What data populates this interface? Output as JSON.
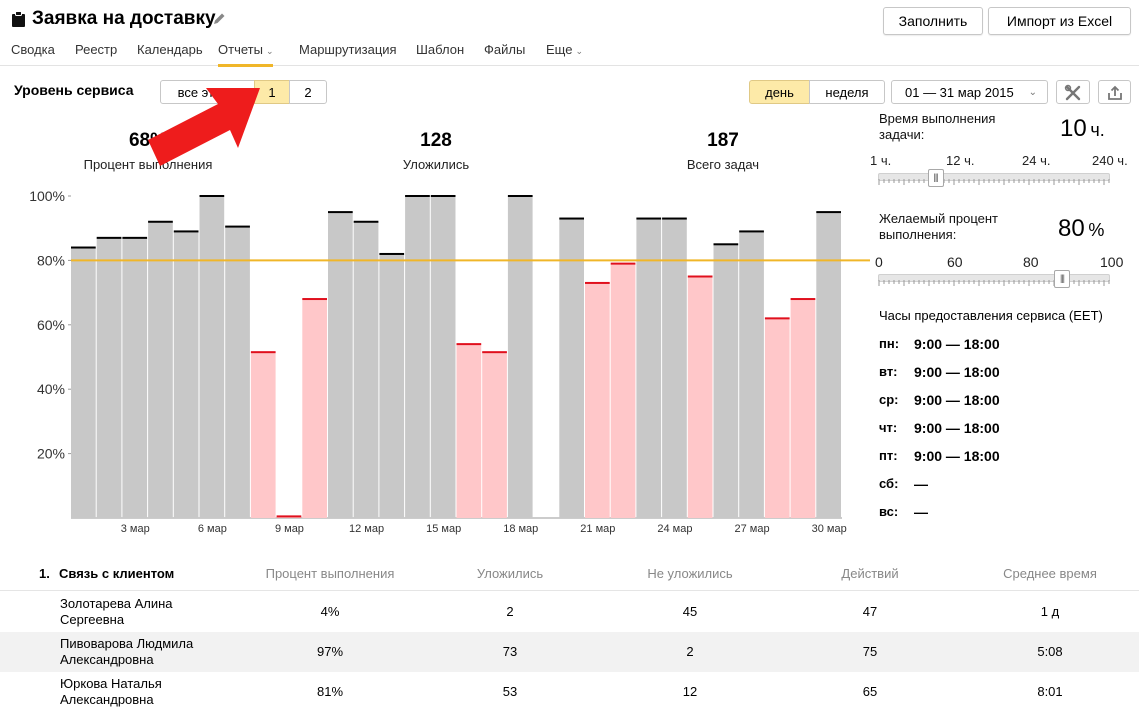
{
  "header": {
    "title": "Заявка на доставку",
    "fill_button": "Заполнить",
    "import_button": "Импорт из Excel"
  },
  "tabs": [
    {
      "label": "Сводка",
      "active": false
    },
    {
      "label": "Реестр",
      "active": false
    },
    {
      "label": "Календарь",
      "active": false
    },
    {
      "label": "Отчеты",
      "active": true,
      "dropdown": true
    },
    {
      "label": "Маршрутизация",
      "active": false
    },
    {
      "label": "Шаблон",
      "active": false
    },
    {
      "label": "Файлы",
      "active": false
    },
    {
      "label": "Еще",
      "active": false,
      "dropdown": true
    }
  ],
  "toolbar": {
    "report_title": "Уровень сервиса",
    "stages": [
      "все этапы",
      "1",
      "2"
    ],
    "selected_stage": "1",
    "periods": [
      "день",
      "неделя"
    ],
    "selected_period": "день",
    "date_range": "01 — 31 мар 2015"
  },
  "stats": [
    {
      "value": "68%",
      "label": "Процент выполнения"
    },
    {
      "value": "128",
      "label": "Уложились"
    },
    {
      "value": "187",
      "label": "Всего задач"
    }
  ],
  "chart_data": {
    "type": "bar",
    "ylim": [
      0,
      100
    ],
    "y_ticks": [
      "20%",
      "40%",
      "60%",
      "80%",
      "100%"
    ],
    "target_line": 80,
    "x_tick_labels": [
      "3 мар",
      "6 мар",
      "9 мар",
      "12 мар",
      "15 мар",
      "18 мар",
      "21 мар",
      "24 мар",
      "27 мар",
      "30 мар"
    ],
    "series": [
      {
        "values": [
          84,
          87,
          87,
          92,
          89,
          100,
          90.5,
          51.5,
          0.5,
          68,
          95,
          92,
          82,
          100,
          100,
          54,
          51.5,
          100,
          null,
          93,
          73,
          79,
          93,
          93,
          75,
          85,
          89,
          62,
          68,
          95
        ]
      }
    ],
    "colors": {
      "met": "#c8c8c8",
      "missed": "#ffc7c9",
      "met_cap": "#000000",
      "missed_cap": "#e0101d",
      "target": "#f0b629"
    }
  },
  "settings": {
    "task_time_label": "Время выполнения задачи:",
    "task_time_value": "10",
    "task_time_unit": "ч.",
    "task_time_scale": [
      "1 ч.",
      "12 ч.",
      "24 ч.",
      "240 ч."
    ],
    "task_time_level": 0.25,
    "target_label": "Желаемый процент выполнения:",
    "target_value": "80",
    "target_unit": "%",
    "target_scale": [
      "0",
      "60",
      "80",
      "100"
    ],
    "target_level": 0.8,
    "hours_title": "Часы предоставления сервиса (EET)",
    "hours": [
      {
        "day": "пн:",
        "time": "9:00 — 18:00"
      },
      {
        "day": "вт:",
        "time": "9:00 — 18:00"
      },
      {
        "day": "ср:",
        "time": "9:00 — 18:00"
      },
      {
        "day": "чт:",
        "time": "9:00 — 18:00"
      },
      {
        "day": "пт:",
        "time": "9:00 — 18:00"
      },
      {
        "day": "сб:",
        "time": "—"
      },
      {
        "day": "вс:",
        "time": "—"
      }
    ]
  },
  "table": {
    "section_number": "1.",
    "section_title": "Связь с клиентом",
    "columns": [
      "Процент выполнения",
      "Уложились",
      "Не уложились",
      "Действий",
      "Среднее время"
    ],
    "rows": [
      {
        "name_line1": "Золотарева Алина",
        "name_line2": "Сергеевна",
        "percent": "4%",
        "met": "2",
        "missed": "45",
        "actions": "47",
        "avg_time": "1 д"
      },
      {
        "name_line1": "Пивоварова Людмила",
        "name_line2": "Александровна",
        "percent": "97%",
        "met": "73",
        "missed": "2",
        "actions": "75",
        "avg_time": "5:08"
      },
      {
        "name_line1": "Юркова Наталья",
        "name_line2": "Александровна",
        "percent": "81%",
        "met": "53",
        "missed": "12",
        "actions": "65",
        "avg_time": "8:01"
      }
    ]
  }
}
